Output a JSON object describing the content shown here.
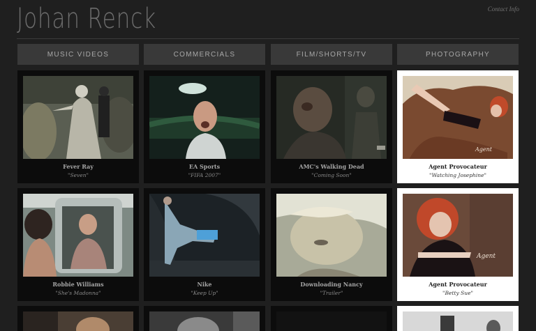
{
  "site": {
    "title": "Johan Renck",
    "contact_label": "Contact Info"
  },
  "nav": {
    "tabs": [
      {
        "label": "MUSIC VIDEOS"
      },
      {
        "label": "COMMERCIALS"
      },
      {
        "label": "FILM/SHORTS/TV"
      },
      {
        "label": "PHOTOGRAPHY"
      }
    ]
  },
  "cards": [
    {
      "title": "Fever Ray",
      "subtitle": "\"Seven\""
    },
    {
      "title": "EA Sports",
      "subtitle": "\"FIFA 2007\""
    },
    {
      "title": "AMC's Walking Dead",
      "subtitle": "\"Coming Soon\""
    },
    {
      "title": "Agent Provocateur",
      "subtitle": "\"Watching Josephine\""
    },
    {
      "title": "Robbie Williams",
      "subtitle": "\"She's Madonna\""
    },
    {
      "title": "Nike",
      "subtitle": "\"Keep Up\""
    },
    {
      "title": "Downloading Nancy",
      "subtitle": "\"Trailer\""
    },
    {
      "title": "Agent Provocateur",
      "subtitle": "\"Betty Sue\""
    }
  ]
}
